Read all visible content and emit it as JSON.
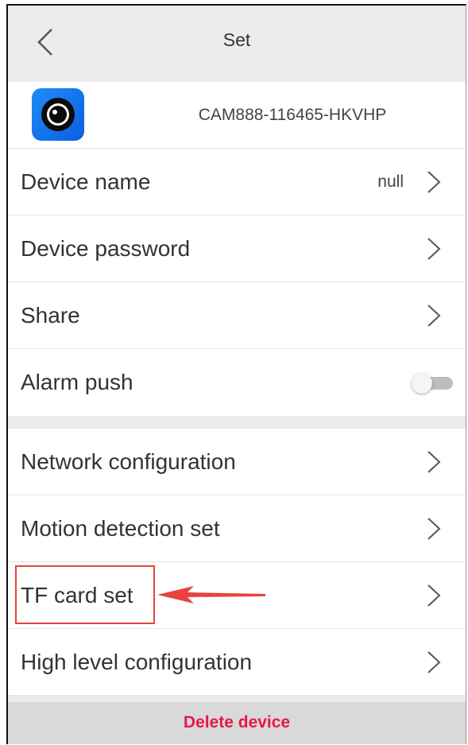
{
  "header": {
    "title": "Set"
  },
  "device": {
    "id": "CAM888-116465-HKVHP"
  },
  "rows": [
    {
      "label": "Device name",
      "value": "null"
    },
    {
      "label": "Device password"
    },
    {
      "label": "Share"
    },
    {
      "label": "Alarm push",
      "toggle": false
    },
    {
      "label": "Network configuration"
    },
    {
      "label": "Motion detection set"
    },
    {
      "label": "TF card set",
      "highlighted": true
    },
    {
      "label": "High level configuration"
    }
  ],
  "footer": {
    "delete_label": "Delete device"
  },
  "colors": {
    "header_bg": "#ececec",
    "delete_text": "#e5194b",
    "annotation_red": "#e8433d",
    "app_icon_blue": "#1f8cf7"
  },
  "icons": [
    "back-arrow-icon",
    "camera-eye-app-icon",
    "chevron-right-icon"
  ]
}
